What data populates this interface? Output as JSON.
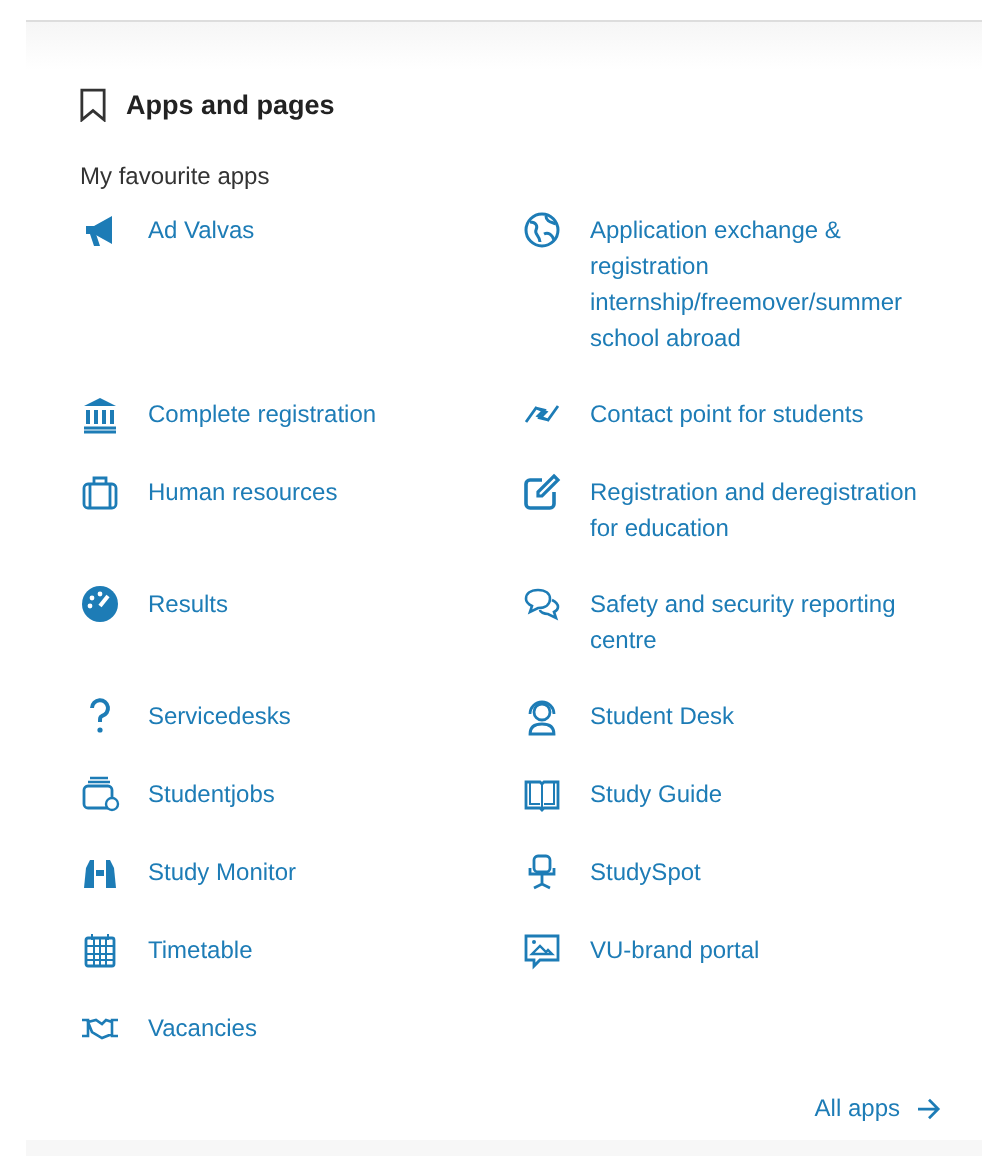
{
  "section": {
    "title": "Apps and pages",
    "subtitle": "My favourite apps"
  },
  "apps": [
    {
      "label": "Ad Valvas"
    },
    {
      "label": "Application exchange & registration internship/freemover/summer school abroad"
    },
    {
      "label": "Complete registration"
    },
    {
      "label": "Contact point for students"
    },
    {
      "label": "Human resources"
    },
    {
      "label": "Registration and deregistration for education"
    },
    {
      "label": "Results"
    },
    {
      "label": "Safety and security reporting centre"
    },
    {
      "label": "Servicedesks"
    },
    {
      "label": "Student Desk"
    },
    {
      "label": "Studentjobs"
    },
    {
      "label": "Study Guide"
    },
    {
      "label": "Study Monitor"
    },
    {
      "label": "StudySpot"
    },
    {
      "label": "Timetable"
    },
    {
      "label": "VU-brand portal"
    },
    {
      "label": "Vacancies"
    }
  ],
  "all_apps": {
    "label": "All apps"
  }
}
